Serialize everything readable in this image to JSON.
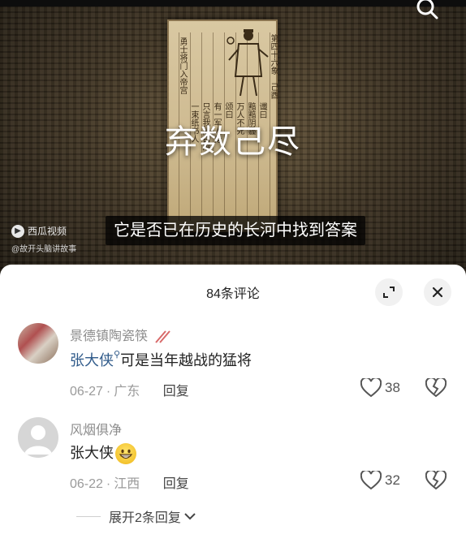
{
  "video": {
    "overlay_title": "弃数己尽",
    "subtitle": "它是否已在历史的长河中找到答案",
    "watermark_brand": "西瓜视频",
    "watermark_author": "@故开头脑讲故事",
    "scroll_text": [
      "第四十六象",
      "己酉",
      "谶曰",
      "黯黯阴霾",
      "万人不死",
      "颂曰",
      "有一军人身",
      "只言我是白鸠",
      "一束纸书人",
      "勇士将门入帝宫"
    ]
  },
  "comments_panel": {
    "count_label": "84条评论",
    "comments": [
      {
        "username": "景德镇陶瓷筷",
        "mention": "张大侠",
        "text": "可是当年越战的猛将",
        "date": "06-27",
        "location": "广东",
        "reply_label": "回复",
        "likes": "38"
      },
      {
        "username": "风烟俱净",
        "mention": "张大侠",
        "text": "",
        "emoji": "grinning-face",
        "date": "06-22",
        "location": "江西",
        "reply_label": "回复",
        "likes": "32"
      }
    ],
    "expand_replies_label": "展开2条回复"
  },
  "icons": {
    "search": "search-icon",
    "expand": "expand-icon",
    "close": "close-icon",
    "like": "heart-icon",
    "dislike": "broken-heart-icon",
    "chevron": "chevron-down-icon"
  }
}
